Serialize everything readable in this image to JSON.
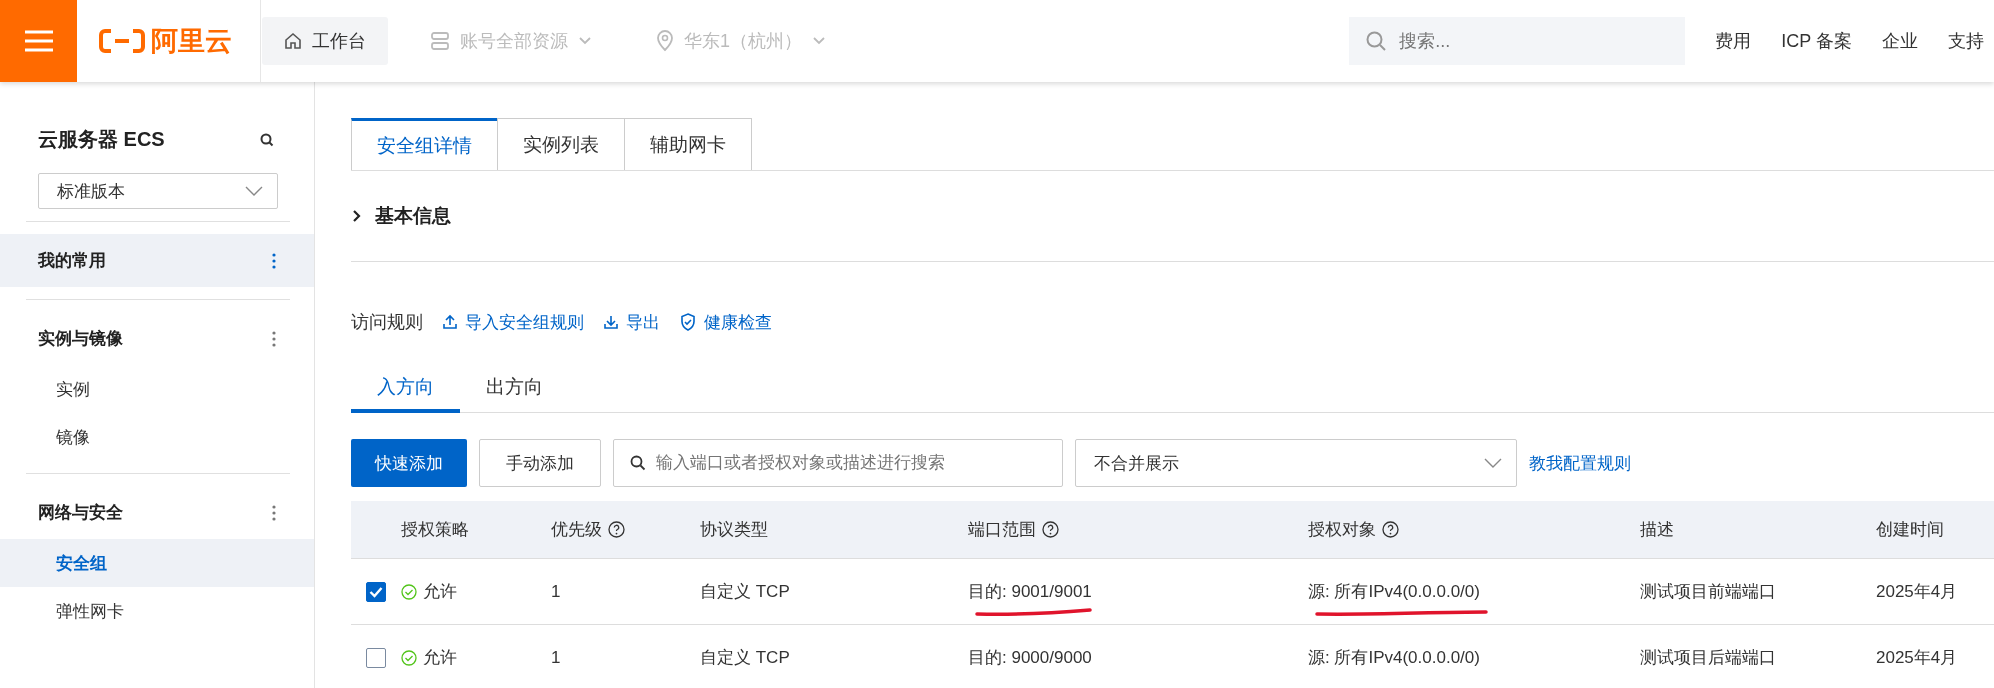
{
  "topbar": {
    "logo": "阿里云",
    "nav": [
      {
        "label": "工作台",
        "kind": "home",
        "selected": true
      },
      {
        "label": "账号全部资源",
        "kind": "resources",
        "selected": false
      },
      {
        "label": "华东1（杭州）",
        "kind": "region",
        "selected": false
      }
    ],
    "search": {
      "placeholder": "搜索..."
    },
    "links": [
      "费用",
      "ICP 备案",
      "企业",
      "支持"
    ]
  },
  "sidebar": {
    "title": "云服务器 ECS",
    "version_select": "标准版本",
    "groups": [
      {
        "label": "我的常用",
        "highlighted": true
      },
      {
        "label": "实例与镜像",
        "highlighted": false,
        "items": [
          {
            "label": "实例",
            "selected": false
          },
          {
            "label": "镜像",
            "selected": false
          }
        ]
      },
      {
        "label": "网络与安全",
        "highlighted": false,
        "items": [
          {
            "label": "安全组",
            "selected": true
          },
          {
            "label": "弹性网卡",
            "selected": false
          }
        ]
      }
    ]
  },
  "tabs": [
    {
      "label": "安全组详情",
      "selected": true
    },
    {
      "label": "实例列表",
      "selected": false
    },
    {
      "label": "辅助网卡",
      "selected": false
    }
  ],
  "section": {
    "label": "基本信息",
    "expanded": false
  },
  "rules": {
    "title": "访问规则",
    "actions": [
      {
        "label": "导入安全组规则",
        "kind": "upload"
      },
      {
        "label": "导出",
        "kind": "download"
      },
      {
        "label": "健康检查",
        "kind": "shield"
      }
    ],
    "direction_tabs": [
      {
        "label": "入方向",
        "selected": true
      },
      {
        "label": "出方向",
        "selected": false
      }
    ],
    "toolbar": {
      "quick_add": "快速添加",
      "manual_add": "手动添加",
      "search_placeholder": "输入端口或者授权对象或描述进行搜索",
      "merge_select": "不合并展示",
      "help_link": "教我配置规则"
    },
    "columns": [
      {
        "label": "授权策略",
        "help": false
      },
      {
        "label": "优先级",
        "help": true
      },
      {
        "label": "协议类型",
        "help": false
      },
      {
        "label": "端口范围",
        "help": true
      },
      {
        "label": "授权对象",
        "help": true
      },
      {
        "label": "描述",
        "help": false
      },
      {
        "label": "创建时间",
        "help": false
      }
    ],
    "rows": [
      {
        "checked": true,
        "policy": "允许",
        "priority": "1",
        "protocol": "自定义 TCP",
        "port": "目的: 9001/9001",
        "port_marked": true,
        "source": "源: 所有IPv4(0.0.0.0/0)",
        "source_marked": true,
        "description": "测试项目前端端口",
        "created": "2025年4月"
      },
      {
        "checked": false,
        "policy": "允许",
        "priority": "1",
        "protocol": "自定义 TCP",
        "port": "目的: 9000/9000",
        "port_marked": false,
        "source": "源: 所有IPv4(0.0.0.0/0)",
        "source_marked": false,
        "description": "测试项目后端端口",
        "created": "2025年4月"
      }
    ]
  }
}
